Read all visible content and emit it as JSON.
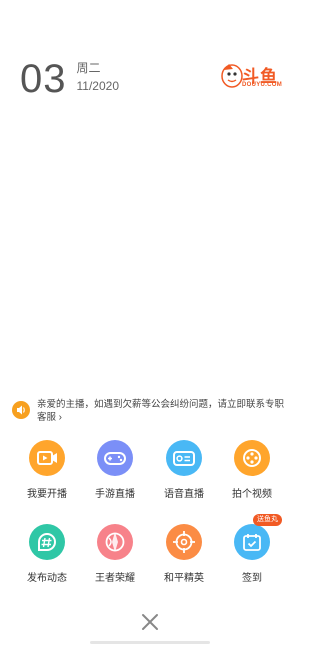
{
  "header": {
    "day": "03",
    "weekday": "周二",
    "month_year": "11/2020"
  },
  "logo": {
    "text_cn": "斗鱼",
    "text_en": "DOUYU.COM",
    "color": "#f15a24"
  },
  "notice": {
    "icon": "speaker-icon",
    "text": "亲爱的主播，如遇到欠薪等公会纠纷问题，请立即联系专职客服",
    "arrow": "›"
  },
  "actions_row1": [
    {
      "label": "我要开播",
      "icon": "live-camera-icon",
      "color": "#ffa52c"
    },
    {
      "label": "手游直播",
      "icon": "gamepad-icon",
      "color": "#7b8ff7"
    },
    {
      "label": "语音直播",
      "icon": "voice-card-icon",
      "color": "#49b8f5"
    },
    {
      "label": "拍个视频",
      "icon": "video-reel-icon",
      "color": "#ffa52c"
    }
  ],
  "actions_row2": [
    {
      "label": "发布动态",
      "icon": "hashtag-icon",
      "color": "#2fc7a6"
    },
    {
      "label": "王者荣耀",
      "icon": "king-glory-icon",
      "color": "#f7828a"
    },
    {
      "label": "和平精英",
      "icon": "crosshair-icon",
      "color": "#fb8c45"
    },
    {
      "label": "签到",
      "icon": "calendar-check-icon",
      "color": "#49b8f5",
      "badge": "送鱼丸"
    }
  ],
  "close": {
    "icon": "close-icon"
  }
}
